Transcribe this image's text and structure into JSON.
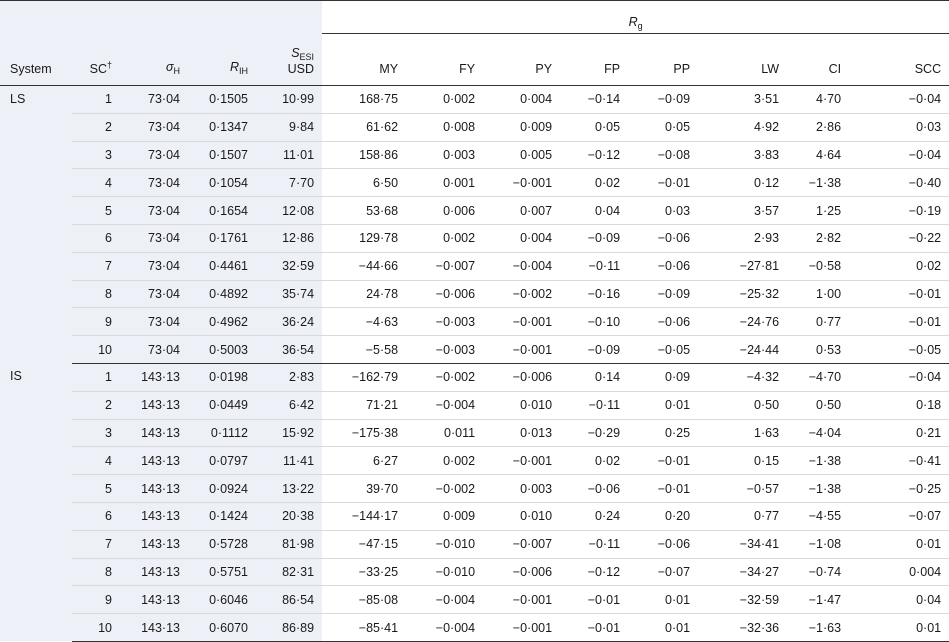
{
  "header": {
    "rg_label": "R",
    "rg_sub": "g",
    "columns": [
      {
        "key": "system",
        "label": "System"
      },
      {
        "key": "sc",
        "label": "SC",
        "sup": "†"
      },
      {
        "key": "sigma",
        "label": "σ",
        "sub": "H"
      },
      {
        "key": "rih",
        "label": "R",
        "sub": "IH"
      },
      {
        "key": "sesi",
        "label": "S",
        "sub": "ESI",
        "line2": "USD"
      },
      {
        "key": "my",
        "label": "MY"
      },
      {
        "key": "fy",
        "label": "FY"
      },
      {
        "key": "py",
        "label": "PY"
      },
      {
        "key": "fp",
        "label": "FP"
      },
      {
        "key": "pp",
        "label": "PP"
      },
      {
        "key": "lw",
        "label": "LW"
      },
      {
        "key": "ci",
        "label": "CI"
      },
      {
        "key": "scc",
        "label": "SCC"
      }
    ]
  },
  "groups": [
    {
      "system": "LS",
      "rows": [
        [
          "1",
          "73·04",
          "0·1505",
          "10·99",
          "168·75",
          "0·002",
          "0·004",
          "−0·14",
          "−0·09",
          "3·51",
          "4·70",
          "−0·04"
        ],
        [
          "2",
          "73·04",
          "0·1347",
          "9·84",
          "61·62",
          "0·008",
          "0·009",
          "0·05",
          "0·05",
          "4·92",
          "2·86",
          "0·03"
        ],
        [
          "3",
          "73·04",
          "0·1507",
          "11·01",
          "158·86",
          "0·003",
          "0·005",
          "−0·12",
          "−0·08",
          "3·83",
          "4·64",
          "−0·04"
        ],
        [
          "4",
          "73·04",
          "0·1054",
          "7·70",
          "6·50",
          "0·001",
          "−0·001",
          "0·02",
          "−0·01",
          "0·12",
          "−1·38",
          "−0·40"
        ],
        [
          "5",
          "73·04",
          "0·1654",
          "12·08",
          "53·68",
          "0·006",
          "0·007",
          "0·04",
          "0·03",
          "3·57",
          "1·25",
          "−0·19"
        ],
        [
          "6",
          "73·04",
          "0·1761",
          "12·86",
          "129·78",
          "0·002",
          "0·004",
          "−0·09",
          "−0·06",
          "2·93",
          "2·82",
          "−0·22"
        ],
        [
          "7",
          "73·04",
          "0·4461",
          "32·59",
          "−44·66",
          "−0·007",
          "−0·004",
          "−0·11",
          "−0·06",
          "−27·81",
          "−0·58",
          "0·02"
        ],
        [
          "8",
          "73·04",
          "0·4892",
          "35·74",
          "24·78",
          "−0·006",
          "−0·002",
          "−0·16",
          "−0·09",
          "−25·32",
          "1·00",
          "−0·01"
        ],
        [
          "9",
          "73·04",
          "0·4962",
          "36·24",
          "−4·63",
          "−0·003",
          "−0·001",
          "−0·10",
          "−0·06",
          "−24·76",
          "0·77",
          "−0·01"
        ],
        [
          "10",
          "73·04",
          "0·5003",
          "36·54",
          "−5·58",
          "−0·003",
          "−0·001",
          "−0·09",
          "−0·05",
          "−24·44",
          "0·53",
          "−0·05"
        ]
      ]
    },
    {
      "system": "IS",
      "rows": [
        [
          "1",
          "143·13",
          "0·0198",
          "2·83",
          "−162·79",
          "−0·002",
          "−0·006",
          "0·14",
          "0·09",
          "−4·32",
          "−4·70",
          "−0·04"
        ],
        [
          "2",
          "143·13",
          "0·0449",
          "6·42",
          "71·21",
          "−0·004",
          "0·010",
          "−0·11",
          "0·01",
          "0·50",
          "0·50",
          "0·18"
        ],
        [
          "3",
          "143·13",
          "0·1112",
          "15·92",
          "−175·38",
          "0·011",
          "0·013",
          "−0·29",
          "0·25",
          "1·63",
          "−4·04",
          "0·21"
        ],
        [
          "4",
          "143·13",
          "0·0797",
          "11·41",
          "6·27",
          "0·002",
          "−0·001",
          "0·02",
          "−0·01",
          "0·15",
          "−1·38",
          "−0·41"
        ],
        [
          "5",
          "143·13",
          "0·0924",
          "13·22",
          "39·70",
          "−0·002",
          "0·003",
          "−0·06",
          "−0·01",
          "−0·57",
          "−1·38",
          "−0·25"
        ],
        [
          "6",
          "143·13",
          "0·1424",
          "20·38",
          "−144·17",
          "0·009",
          "0·010",
          "0·24",
          "0·20",
          "0·77",
          "−4·55",
          "−0·07"
        ],
        [
          "7",
          "143·13",
          "0·5728",
          "81·98",
          "−47·15",
          "−0·010",
          "−0·007",
          "−0·11",
          "−0·06",
          "−34·41",
          "−1·08",
          "0·01"
        ],
        [
          "8",
          "143·13",
          "0·5751",
          "82·31",
          "−33·25",
          "−0·010",
          "−0·006",
          "−0·12",
          "−0·07",
          "−34·27",
          "−0·74",
          "0·004"
        ],
        [
          "9",
          "143·13",
          "0·6046",
          "86·54",
          "−85·08",
          "−0·004",
          "−0·001",
          "−0·01",
          "0·01",
          "−32·59",
          "−1·47",
          "0·04"
        ],
        [
          "10",
          "143·13",
          "0·6070",
          "86·89",
          "−85·41",
          "−0·004",
          "−0·001",
          "−0·01",
          "0·01",
          "−32·36",
          "−1·63",
          "0·01"
        ]
      ]
    }
  ]
}
